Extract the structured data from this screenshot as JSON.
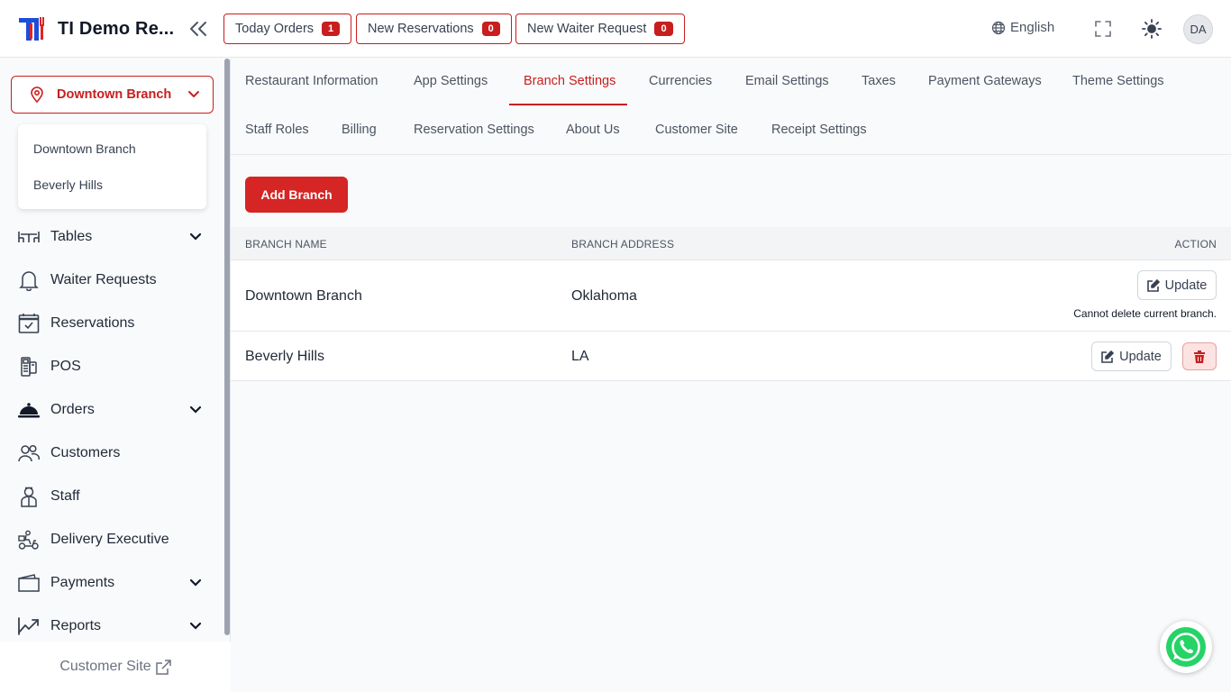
{
  "header": {
    "app_title": "TI Demo Re...",
    "pills": [
      {
        "label": "Today Orders",
        "count": "1"
      },
      {
        "label": "New Reservations",
        "count": "0"
      },
      {
        "label": "New Waiter Request",
        "count": "0"
      }
    ],
    "language": "English",
    "avatar_initials": "DA"
  },
  "sidebar": {
    "branch_selected": "Downtown Branch",
    "branch_options": [
      "Downtown Branch",
      "Beverly Hills"
    ],
    "items": [
      {
        "label": "Tables",
        "icon": "table-icon",
        "has_submenu": true
      },
      {
        "label": "Waiter Requests",
        "icon": "bell-icon",
        "has_submenu": false
      },
      {
        "label": "Reservations",
        "icon": "calendar-check-icon",
        "has_submenu": false
      },
      {
        "label": "POS",
        "icon": "pos-terminal-icon",
        "has_submenu": false
      },
      {
        "label": "Orders",
        "icon": "food-cloche-icon",
        "has_submenu": true
      },
      {
        "label": "Customers",
        "icon": "users-icon",
        "has_submenu": false
      },
      {
        "label": "Staff",
        "icon": "staff-icon",
        "has_submenu": false
      },
      {
        "label": "Delivery Executive",
        "icon": "scooter-icon",
        "has_submenu": false
      },
      {
        "label": "Payments",
        "icon": "wallet-icon",
        "has_submenu": true
      },
      {
        "label": "Reports",
        "icon": "chart-line-icon",
        "has_submenu": true
      }
    ],
    "customer_site_label": "Customer Site"
  },
  "settings": {
    "tabs_row1": [
      "Restaurant Information",
      "App Settings",
      "Branch Settings",
      "Currencies",
      "Email Settings",
      "Taxes",
      "Payment Gateways",
      "Theme Settings"
    ],
    "tabs_row2": [
      "Staff Roles",
      "Billing",
      "Reservation Settings",
      "About Us",
      "Customer Site",
      "Receipt Settings"
    ],
    "active_tab": "Branch Settings"
  },
  "branches": {
    "add_button_label": "Add Branch",
    "columns": [
      "Branch Name",
      "Branch Address",
      "Action"
    ],
    "rows": [
      {
        "name": "Downtown Branch",
        "address": "Oklahoma",
        "update_label": "Update",
        "note": "Cannot delete current branch.",
        "deletable": false
      },
      {
        "name": "Beverly Hills",
        "address": "LA",
        "update_label": "Update",
        "note": "",
        "deletable": true
      }
    ]
  },
  "colors": {
    "accent": "#c81e1e",
    "primary_button": "#d52525",
    "whatsapp_green": "#25d366"
  }
}
